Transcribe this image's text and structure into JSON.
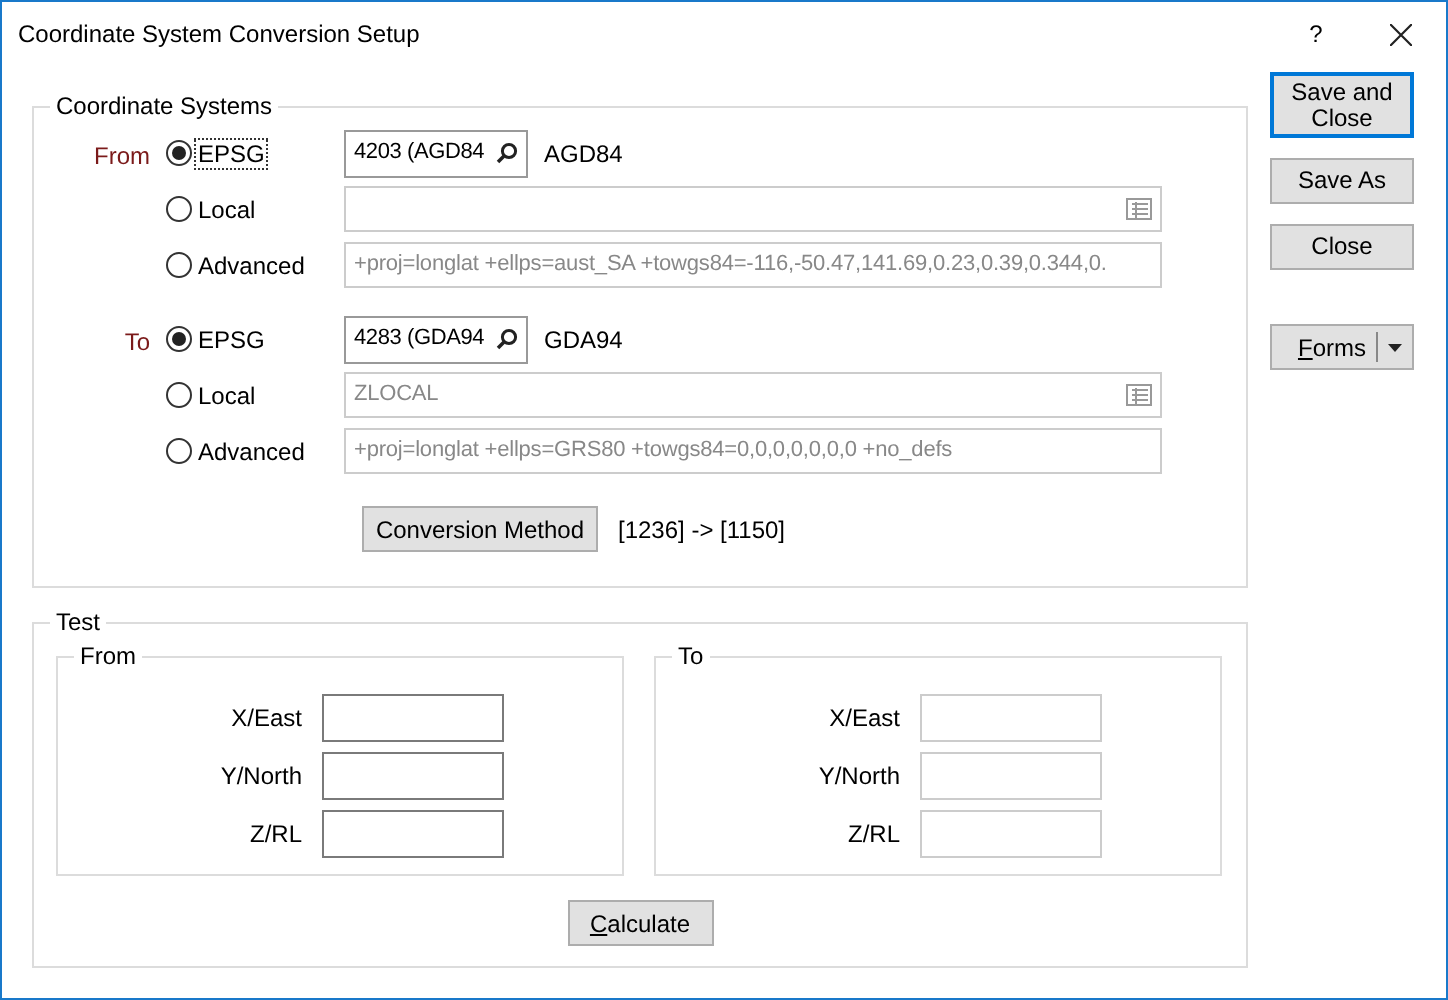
{
  "window": {
    "title": "Coordinate System Conversion Setup",
    "help": "?"
  },
  "coordinate_systems": {
    "title": "Coordinate Systems",
    "groups": [
      {
        "label": "From",
        "options": [
          {
            "kind": "epsg",
            "label": "EPSG",
            "selected": true,
            "focused": true,
            "value": "4203 (AGD84",
            "name": "AGD84"
          },
          {
            "kind": "local",
            "label": "Local",
            "selected": false,
            "focused": false
          },
          {
            "kind": "advanced",
            "label": "Advanced",
            "selected": false,
            "focused": false,
            "value": "+proj=longlat +ellps=aust_SA +towgs84=-116,-50.47,141.69,0.23,0.39,0.344,0."
          }
        ]
      },
      {
        "label": "To",
        "options": [
          {
            "kind": "epsg",
            "label": "EPSG",
            "selected": true,
            "focused": false,
            "value": "4283 (GDA94",
            "name": "GDA94"
          },
          {
            "kind": "local",
            "label": "Local",
            "selected": false,
            "focused": false,
            "value": "ZLOCAL"
          },
          {
            "kind": "advanced",
            "label": "Advanced",
            "selected": false,
            "focused": false,
            "value": "+proj=longlat +ellps=GRS80 +towgs84=0,0,0,0,0,0,0 +no_defs"
          }
        ]
      }
    ],
    "conversion_button": "Conversion Method",
    "conversion_result": "[1236] -> [1150]"
  },
  "test": {
    "title": "Test",
    "groups": [
      {
        "title": "From",
        "disabled": false,
        "fields": [
          "X/East",
          "Y/North",
          "Z/RL"
        ]
      },
      {
        "title": "To",
        "disabled": true,
        "fields": [
          "X/East",
          "Y/North",
          "Z/RL"
        ]
      }
    ],
    "calculate_button": {
      "mnemonic": "C",
      "rest": "alculate"
    }
  },
  "buttons": [
    {
      "kind": "default",
      "label": "Save and Close"
    },
    {
      "kind": "plain",
      "label": "Save As"
    },
    {
      "kind": "plain",
      "label": "Close"
    },
    {
      "kind": "split",
      "mnemonic": "F",
      "rest": "orms"
    }
  ]
}
